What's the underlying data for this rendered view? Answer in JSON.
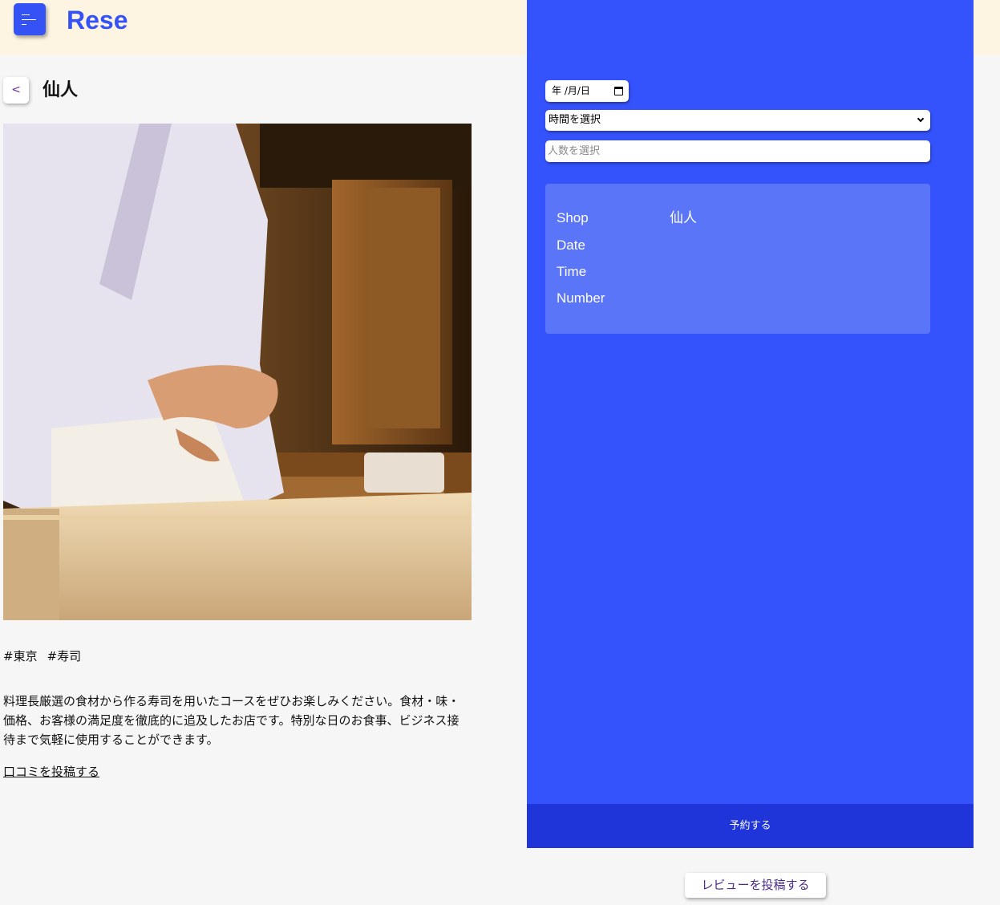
{
  "header": {
    "logo": "Rese"
  },
  "shop": {
    "back_label": "<",
    "name": "仙人",
    "tags": [
      "#東京",
      "#寿司"
    ],
    "description": "料理長厳選の食材から作る寿司を用いたコースをぜひお楽しみください。食材・味・価格、お客様の満足度を徹底的に追及したお店です。特別な日のお食事、ビジネス接待まで気軽に使用することができます。",
    "review_link": "口コミを投稿する"
  },
  "reservation": {
    "date_placeholder": "年 /月/日",
    "time_select": "時間を選択",
    "number_placeholder": "人数を選択",
    "summary": {
      "shop_label": "Shop",
      "shop_value": "仙人",
      "date_label": "Date",
      "time_label": "Time",
      "number_label": "Number"
    },
    "reserve_button": "予約する"
  },
  "post_review_button": "レビューを投稿する",
  "colors": {
    "brand_blue": "#3553fd",
    "header_bg": "#fdf5e2",
    "reserve_btn": "#1f35d9"
  }
}
